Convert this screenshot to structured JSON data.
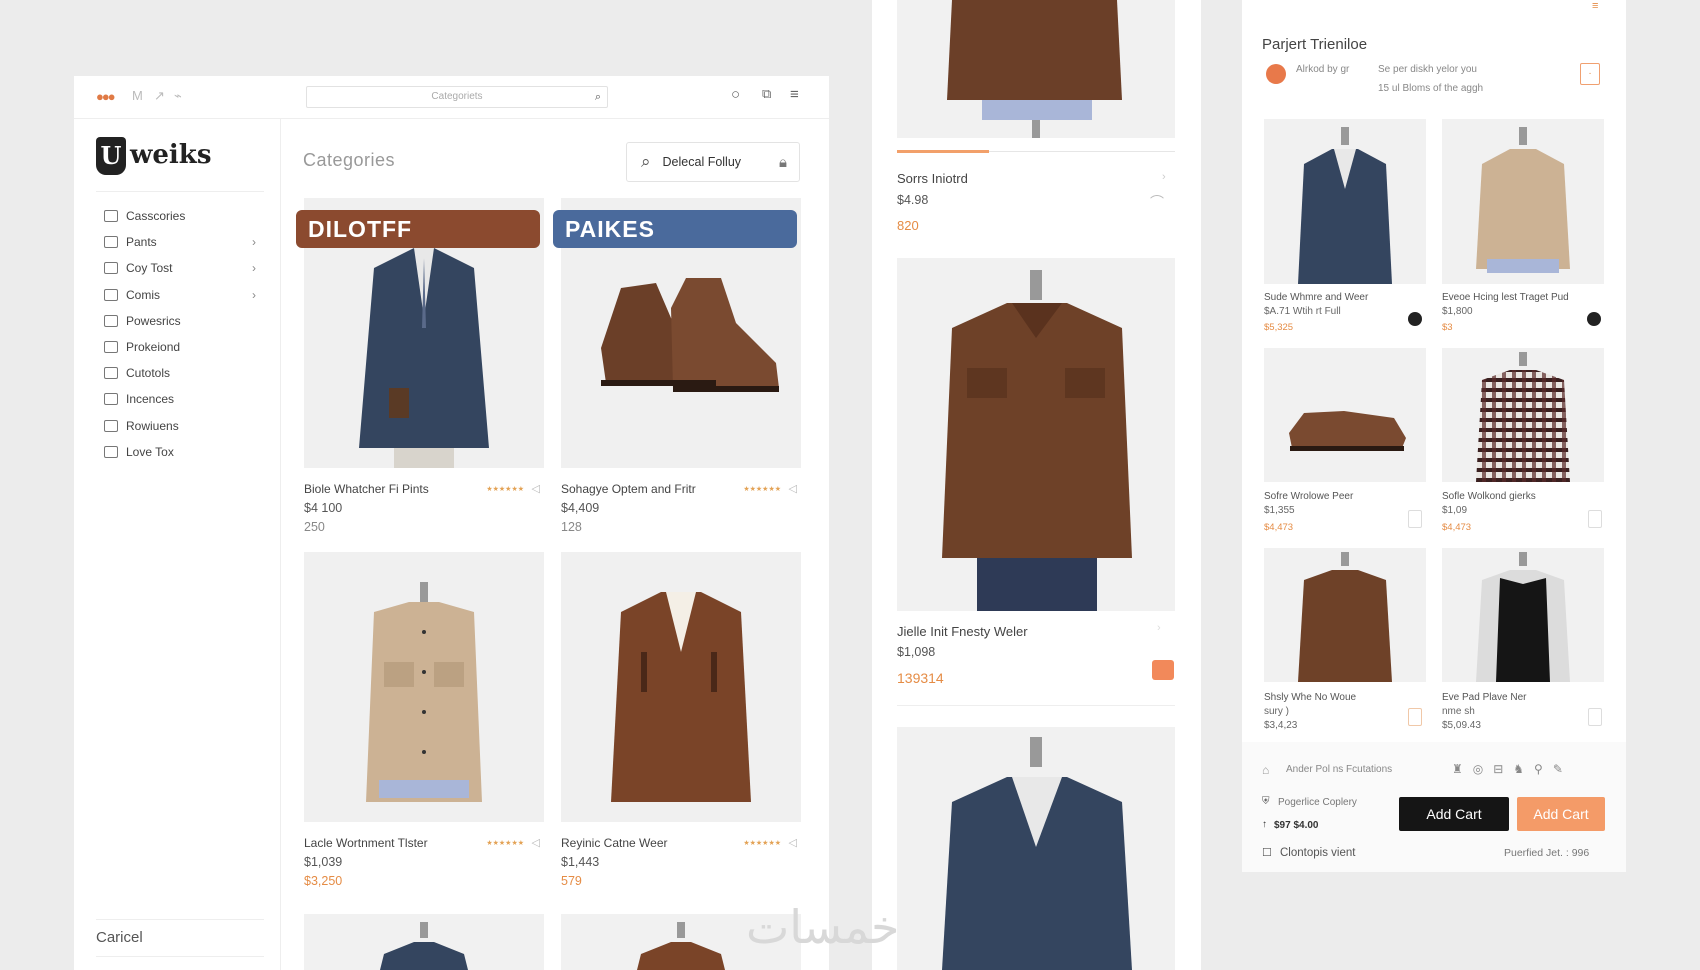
{
  "topbar": {
    "search_placeholder": "Categoriets"
  },
  "brand": {
    "mark": "U",
    "name": "weiks"
  },
  "sidebar": {
    "items": [
      {
        "label": "Casscories",
        "icon": "bookmark-icon",
        "chevron": false
      },
      {
        "label": "Pants",
        "icon": "bag-icon",
        "chevron": true
      },
      {
        "label": "Coy Tost",
        "icon": "card-icon",
        "chevron": true
      },
      {
        "label": "Comis",
        "icon": "calendar-icon",
        "chevron": true
      },
      {
        "label": "Powesrics",
        "icon": "chat-icon",
        "chevron": false
      },
      {
        "label": "Prokeiond",
        "icon": "shield-icon",
        "chevron": false
      },
      {
        "label": "Cutotols",
        "icon": "clock-icon",
        "chevron": false
      },
      {
        "label": "Incences",
        "icon": "chart-icon",
        "chevron": false
      },
      {
        "label": "Rowiuens",
        "icon": "shuffle-icon",
        "chevron": false
      },
      {
        "label": "Love Tox",
        "icon": "triangle-icon",
        "chevron": false
      }
    ],
    "cancel_label": "Caricel"
  },
  "main": {
    "title": "Categories",
    "dropdown_label": "Delecal Folluy",
    "banners": [
      "DILOTFF",
      "PAIKES"
    ],
    "products": [
      {
        "name": "Biole Whatcher Fi Pints",
        "price": "$4 100",
        "price2": "250"
      },
      {
        "name": "Sohagye Optem and Fritr",
        "price": "$4,409",
        "price2": "128"
      },
      {
        "name": "Lacle Wortnment Tlster",
        "price": "$1,039",
        "price2": "$3,250"
      },
      {
        "name": "Reyinic Catne Weer",
        "price": "$1,443",
        "price2": "579"
      }
    ]
  },
  "panel2": {
    "items": [
      {
        "name": "Sorrs Iniotrd",
        "price": "$4.98",
        "price2": "820"
      },
      {
        "name": "Jielle Init Fnesty Weler",
        "price": "$1,098",
        "price2": "139314"
      }
    ]
  },
  "panel3": {
    "title": "Parjert Trieniloe",
    "asked_by": "Alrkod by gr",
    "sub1": "Se per diskh yelor you",
    "sub2": "15 ul Bloms of the aggh",
    "tiles": [
      {
        "name": "Sude Whmre and Weer",
        "price": "$A.71 Wtih rt Full",
        "price2": "$5,325"
      },
      {
        "name": "Eveoe Hcing lest Traget Pud",
        "price": "$1,800",
        "price2": "$3"
      },
      {
        "name": "Sofre Wrolowe Peer",
        "price": "$1,355",
        "price2": "$4,473"
      },
      {
        "name": "Sofle Wolkond gierks",
        "price": "$1,09",
        "price2": "$4,473"
      },
      {
        "name": "Shsly Whe No Woue",
        "price": "sury )",
        "price2": "$3,4,23"
      },
      {
        "name": "Eve Pad Plave Ner",
        "price": "nme sh",
        "price2": "$5,09.43"
      }
    ],
    "footer_links": "Ander Pol ns  Fcutations",
    "shipping": "Pogerlice  Coplery",
    "total": "$97 $4.00",
    "add_cart_dark": "Add Cart",
    "add_cart_orange": "Add Cart",
    "bottom_left": "Clontopis vient",
    "bottom_right": "Puerfied Jet. : 996"
  },
  "watermark": "خمسات",
  "colors": {
    "accent": "#f49b68",
    "banner_brown": "#8b4a2f",
    "banner_blue": "#4a6a9c"
  }
}
